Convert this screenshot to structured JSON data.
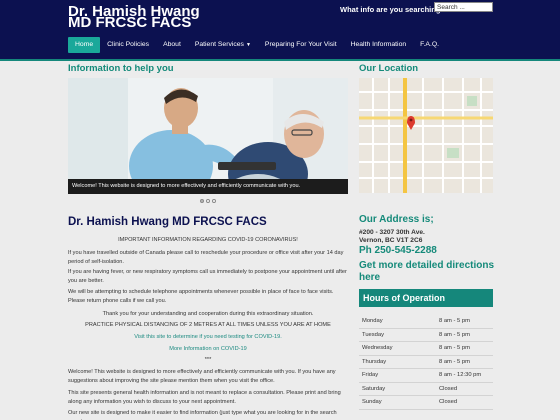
{
  "header": {
    "logo_line1": "Dr. Hamish Hwang",
    "logo_line2": "MD FRCSC FACS",
    "search_label": "What info are you searching for?",
    "search_value": "Search ..."
  },
  "nav": {
    "items": [
      {
        "label": "Home",
        "active": true
      },
      {
        "label": "Clinic Policies"
      },
      {
        "label": "About"
      },
      {
        "label": "Patient Services",
        "has_caret": true
      },
      {
        "label": "Preparing For Your Visit"
      },
      {
        "label": "Health Information"
      },
      {
        "label": "F.A.Q."
      }
    ],
    "caret_icon": "chevron-down-icon"
  },
  "info_heading": "Information to help you",
  "slider": {
    "caption": "Welcome! This website is designed to more effectively and efficiently communicate with you.",
    "dot_count": 3,
    "active_dot": 0
  },
  "location_heading": "Our Location",
  "main": {
    "title": "Dr. Hamish Hwang MD FRCSC FACS",
    "covid_heading": "IMPORTANT INFORMATION REGARDING COVID-19 CORONAVIRUS!",
    "para1": "If you have travelled outside of Canada please call to reschedule your procedure or office visit after your 14 day period of self-isolation.",
    "para2": "If you are having fever, or new respiratory symptoms call us immediately to postpone your appointment until after you are better.",
    "para3": "We will be attempting to schedule telephone appointments whenever possible in place of face to face visits. Please return phone calls if we call you.",
    "para4": "Thank you for your understanding and cooperation during this extraordinary situation.",
    "para5": "PRACTICE PHYSICAL DISTANCING OF 2 METRES AT ALL TIMES UNLESS YOU ARE AT HOME",
    "link1": "Visit this site to determine if you need testing for COVID-19.",
    "link2": "More Information on COVID-19",
    "stars": "***",
    "para6": "Welcome! This website is designed to more effectively and efficiently communicate with you. If you have any suggestions about improving the site please mention them when you visit the office.",
    "para7": "This site presents general health information and is not meant to replace a consultation. Please print and bring along any information you wish to discuss to your next appointment.",
    "para8": "Our new site is designed to make it easier to find information (just type what you are looking for in the search area top"
  },
  "address": {
    "heading": "Our Address is;",
    "line1": "#200 - 3207 30th Ave.",
    "line2": "Vernon, BC V1T 2C6",
    "phone": "Ph 250-545-2288",
    "more_directions": "Get more detailed directions here"
  },
  "hours": {
    "heading": "Hours of Operation",
    "rows": [
      {
        "day": "Monday",
        "time": "8 am - 5 pm"
      },
      {
        "day": "Tuesday",
        "time": "8 am - 5 pm"
      },
      {
        "day": "Wednesday",
        "time": "8 am - 5 pm"
      },
      {
        "day": "Thursday",
        "time": "8 am - 5 pm"
      },
      {
        "day": "Friday",
        "time": "8 am - 12:30 pm"
      },
      {
        "day": "Saturday",
        "time": "Closed"
      },
      {
        "day": "Sunday",
        "time": "Closed"
      }
    ]
  },
  "colors": {
    "header_bg": "#0c1150",
    "accent_teal": "#15877b",
    "nav_active": "#1aa89a"
  }
}
